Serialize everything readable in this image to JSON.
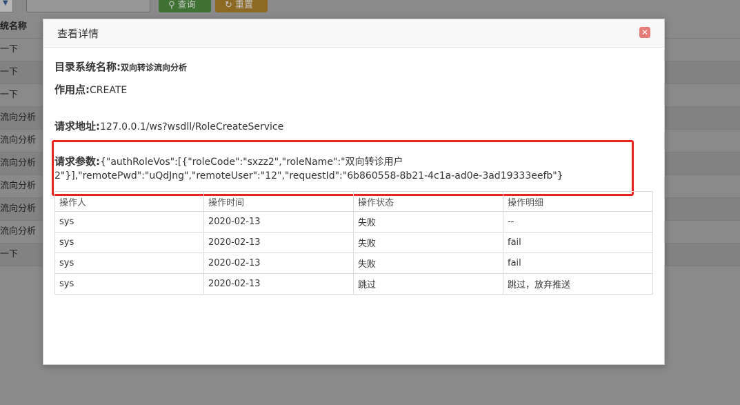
{
  "background": {
    "query_label": "查询",
    "reset_label": "重置",
    "table_header": "统名称",
    "rows": [
      "一下",
      "一下",
      "一下",
      "流向分析",
      "流向分析",
      "流向分析",
      "流向分析",
      "流向分析",
      "流向分析",
      "一下"
    ]
  },
  "modal": {
    "title": "查看详情",
    "close_icon": "close-icon",
    "system_name_label": "目录系统名称:",
    "system_name_value": "双向转诊流向分析",
    "action_point_label": "作用点:",
    "action_point_value": "CREATE",
    "request_url_label": "请求地址:",
    "request_url_value": "127.0.0.1/ws?wsdll/RoleCreateService",
    "request_params_label": "请求参数:",
    "request_params_value": "{\"authRoleVos\":[{\"roleCode\":\"sxzz2\",\"roleName\":\"双向转诊用户2\"}],\"remotePwd\":\"uQdJng\",\"remoteUser\":\"12\",\"requestId\":\"6b860558-8b21-4c1a-ad0e-3ad19333eefb\"}",
    "table": {
      "headers": [
        "操作人",
        "操作时间",
        "操作状态",
        "操作明细"
      ],
      "rows": [
        [
          "sys",
          "2020-02-13",
          "失败",
          "--"
        ],
        [
          "sys",
          "2020-02-13",
          "失败",
          "fail"
        ],
        [
          "sys",
          "2020-02-13",
          "失败",
          "fail"
        ],
        [
          "sys",
          "2020-02-13",
          "跳过",
          "跳过，放弃推送"
        ]
      ]
    }
  },
  "colors": {
    "highlight": "#e8231f",
    "close_button": "#e57c78",
    "overlay": "#8a8a8a"
  }
}
